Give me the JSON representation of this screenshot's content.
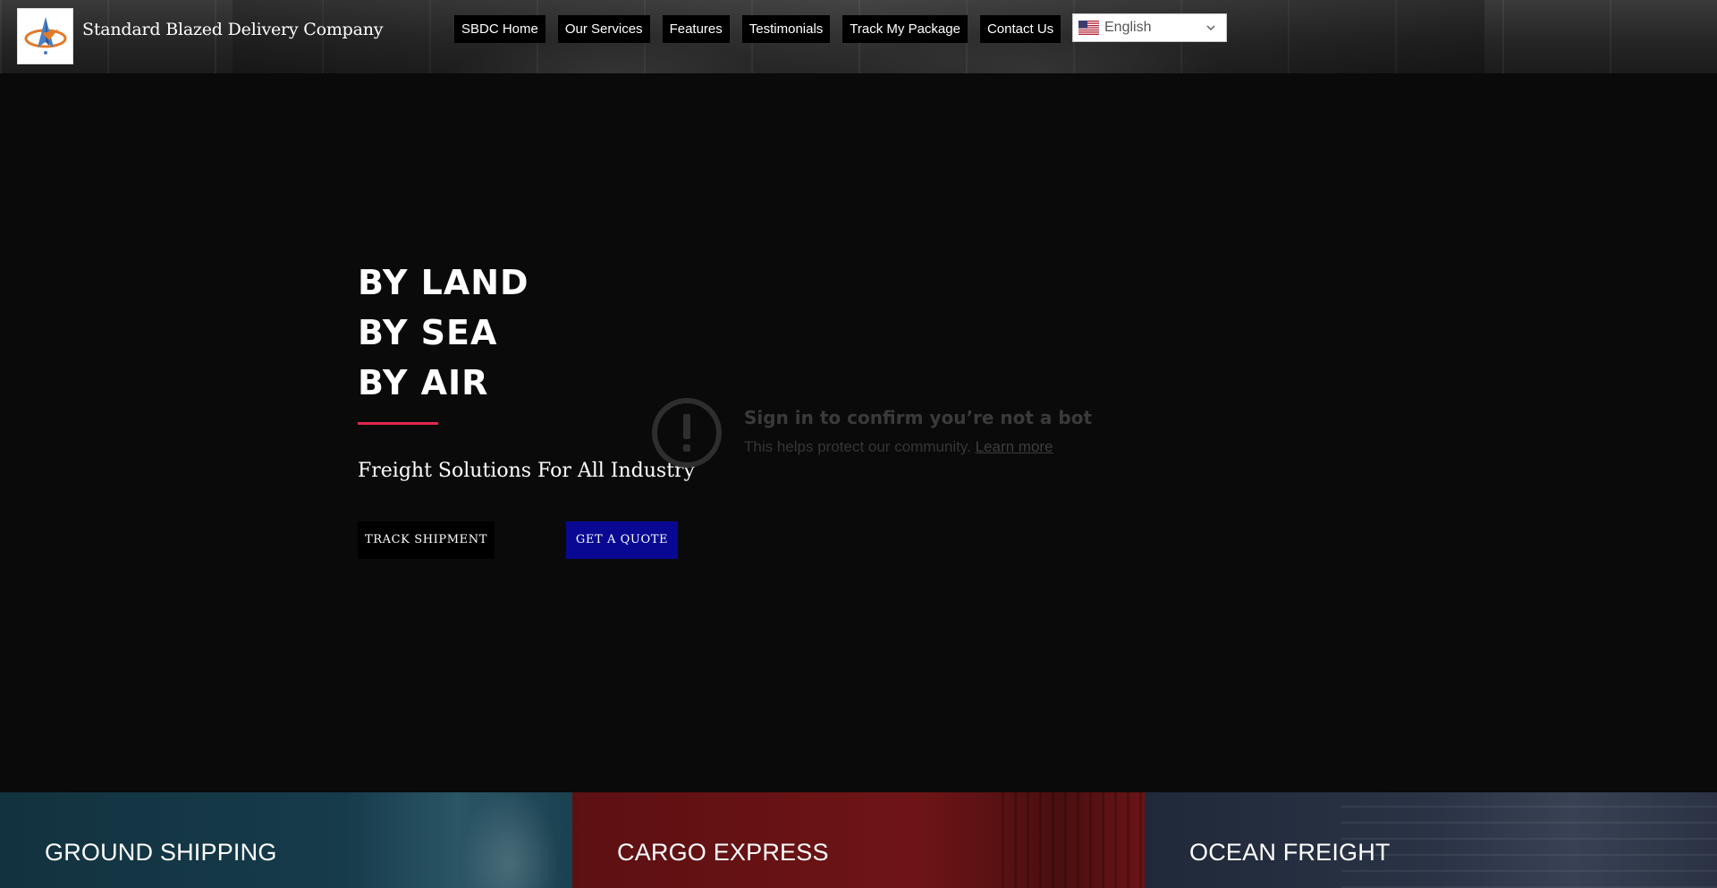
{
  "header": {
    "brand": "Standard Blazed Delivery Company",
    "logo_icon": "rocket-logo-icon",
    "nav": [
      {
        "label": "SBDC Home"
      },
      {
        "label": "Our Services"
      },
      {
        "label": "Features"
      },
      {
        "label": "Testimonials"
      },
      {
        "label": "Track My Package"
      },
      {
        "label": "Contact Us"
      }
    ],
    "language": {
      "selected": "English",
      "flag_icon": "us-flag-icon"
    }
  },
  "hero": {
    "lines": [
      "BY LAND",
      "BY SEA",
      "BY AIR"
    ],
    "tagline": "Freight Solutions For All Industry",
    "buttons": {
      "track": "TRACK SHIPMENT",
      "quote": "GET A QUOTE"
    },
    "accent_color": "#e0284d",
    "quote_button_color": "#080893"
  },
  "bot_notice": {
    "icon": "alert-circle-icon",
    "title": "Sign in to confirm you’re not a bot",
    "text": "This helps protect our community.",
    "link": "Learn more"
  },
  "services": [
    {
      "title": "GROUND SHIPPING",
      "color": "#163b4b"
    },
    {
      "title": "CARGO EXPRESS",
      "color": "#6e1416"
    },
    {
      "title": "OCEAN FREIGHT",
      "color": "#2a3345"
    }
  ]
}
